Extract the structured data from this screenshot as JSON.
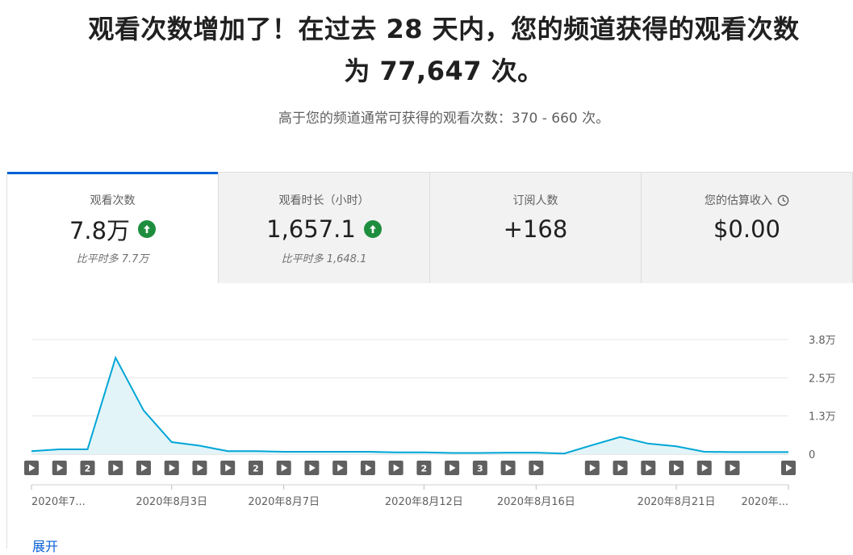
{
  "headline": {
    "line1": "观看次数增加了！在过去 28 天内，您的频道获得的观看次数",
    "line2": "为 77,647 次。"
  },
  "subline": "高于您的频道通常可获得的观看次数：370 - 660 次。",
  "cards": [
    {
      "label": "观看次数",
      "value": "7.8万",
      "trend": "up",
      "note": "比平时多 7.7万",
      "active": true
    },
    {
      "label": "观看时长（小时）",
      "value": "1,657.1",
      "trend": "up",
      "note": "比平时多 1,648.1",
      "active": false
    },
    {
      "label": "订阅人数",
      "value": "+168",
      "trend": "none",
      "note": "",
      "active": false
    },
    {
      "label": "您的估算收入",
      "value": "$0.00",
      "trend": "none",
      "note": "",
      "active": false,
      "icon": "clock-icon"
    }
  ],
  "chart_data": {
    "type": "area",
    "ylabel_ticks": [
      "0",
      "1.3万",
      "2.5万",
      "3.8万"
    ],
    "y_tick_values": [
      0,
      12667,
      25333,
      38000
    ],
    "ylim": [
      0,
      38000
    ],
    "x_tick_labels": [
      {
        "label": "2020年7...",
        "day": 0
      },
      {
        "label": "2020年8月3日",
        "day": 5
      },
      {
        "label": "2020年8月7日",
        "day": 9
      },
      {
        "label": "2020年8月12日",
        "day": 14
      },
      {
        "label": "2020年8月16日",
        "day": 18
      },
      {
        "label": "2020年8月21日",
        "day": 23
      },
      {
        "label": "2020年...",
        "day": 27
      }
    ],
    "values": [
      1000,
      1600,
      1600,
      32000,
      14500,
      4000,
      2800,
      1000,
      1000,
      800,
      800,
      800,
      800,
      600,
      600,
      400,
      400,
      500,
      500,
      200,
      3000,
      5700,
      3500,
      2600,
      800,
      700,
      700,
      700
    ],
    "color": "#00a6d6",
    "fill": "#e3f4f8",
    "grid": true,
    "markers": [
      "play",
      "play",
      "2",
      "play",
      "play",
      "play",
      "play",
      "play",
      "2",
      "play",
      "play",
      "play",
      "play",
      "play",
      "2",
      "play",
      "3",
      "play",
      "play",
      "",
      "play",
      "play",
      "play",
      "play",
      "play",
      "play",
      "",
      "play"
    ]
  },
  "expand_label": "展开"
}
